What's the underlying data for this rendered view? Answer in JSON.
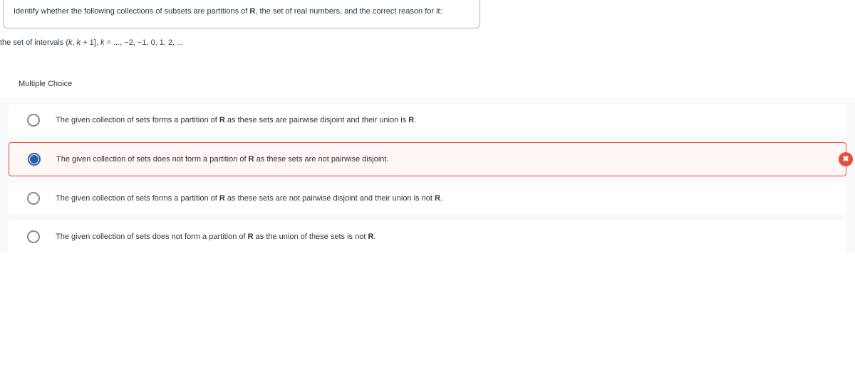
{
  "question": {
    "prompt_pre": "Identify whether the following collections of subsets are partitions of ",
    "prompt_bold": "R",
    "prompt_post": ", the set of real numbers, and the correct reason for it:",
    "sub_pre": "the set of intervals (",
    "sub_k": "k",
    "sub_mid": ", ",
    "sub_k1": "k",
    "sub_plus": " + 1], ",
    "sub_kvar": "k",
    "sub_eq": " = ..., −2, −1, 0, 1, 2, ..."
  },
  "section_label": "Multiple Choice",
  "options": [
    {
      "pre": "The given collection of sets forms a partition of ",
      "bold": "R",
      "mid": " as these sets are pairwise disjoint and their union is ",
      "bold2": "R",
      "post": "."
    },
    {
      "pre": "The given collection of sets does not form a partition of ",
      "bold": "R",
      "mid": " as these sets are not pairwise disjoint.",
      "bold2": "",
      "post": ""
    },
    {
      "pre": "The given collection of sets forms a partition of ",
      "bold": "R",
      "mid": " as these sets are not pairwise disjoint and their union is not ",
      "bold2": "R",
      "post": "."
    },
    {
      "pre": "The given collection of sets does not form a partition of ",
      "bold": "R",
      "mid": " as the union of these sets is not ",
      "bold2": "R",
      "post": "."
    }
  ],
  "wrong_icon": "✖"
}
